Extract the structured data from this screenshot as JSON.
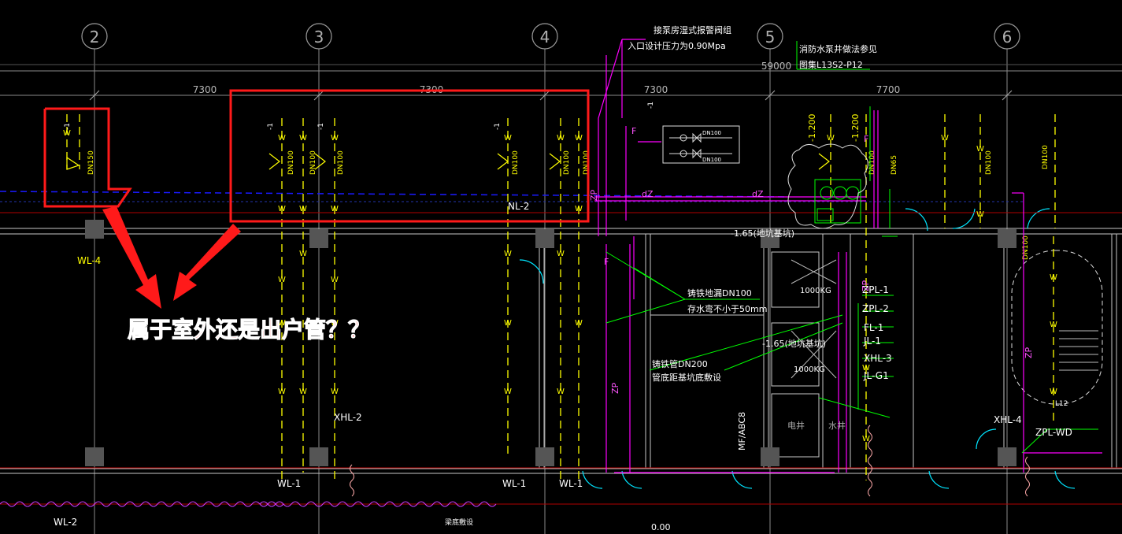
{
  "grid": {
    "axes": [
      "2",
      "3",
      "4",
      "5",
      "6"
    ],
    "spans": [
      "7300",
      "7300",
      "7300",
      "59000",
      "7700"
    ]
  },
  "annotations": {
    "question": "属于室外还是出户管？？",
    "pump_room_note_1": "接泵房湿式报警阀组",
    "pump_room_note_2": "入口设计压力为0.90Mpa",
    "fire_pump_note_1": "消防水泵井做法参见",
    "fire_pump_note_2": "图集L13S2-P12",
    "floor_drain_1": "铸铁地漏DN100",
    "floor_drain_2": "存水弯不小于50mm",
    "cast_pipe_1": "铸铁管DN200",
    "cast_pipe_2": "管底距基坑底敷设",
    "level_1": "-1.65(地坑基坑)",
    "level_2": "-1.65(地坑基坑)",
    "level_3": "0.00",
    "tank_1": "1000KG",
    "tank_2": "1000KG",
    "elec_shaft": "电井",
    "water_shaft": "水井",
    "mfabc": "MF/ABC8",
    "backfill": "梁底敷设",
    "stair_label": "L12"
  },
  "pipe_labels": {
    "wl4": "WL-4",
    "wl1a": "WL-1",
    "wl1b": "WL-1",
    "wl1c": "WL-1",
    "wl2": "WL-2",
    "nl2": "NL-2",
    "xhl2": "XHL-2",
    "xhl4": "XHL-4",
    "zplwd": "ZPL-WD",
    "zpl1": "ZPL-1",
    "zpl2": "ZPL-2",
    "fl1": "FL-1",
    "jl1": "JL-1",
    "xhl3": "XHL-3",
    "jlg1": "JL-G1",
    "dz1": "dZ",
    "dz2": "dZ",
    "elev1": "-1.200",
    "elev2": "-1.200",
    "dn100": "DN100",
    "dn150": "DN150",
    "dn65": "DN65"
  },
  "colors": {
    "background": "#000000",
    "grid_line": "#7f7f7f",
    "drain": "#ffff00",
    "fire": "#ff00ff",
    "rain": "#00ff00",
    "wall": "#c8c8c8",
    "dashed_blue": "#0000ff",
    "highlight": "#ff0000"
  }
}
